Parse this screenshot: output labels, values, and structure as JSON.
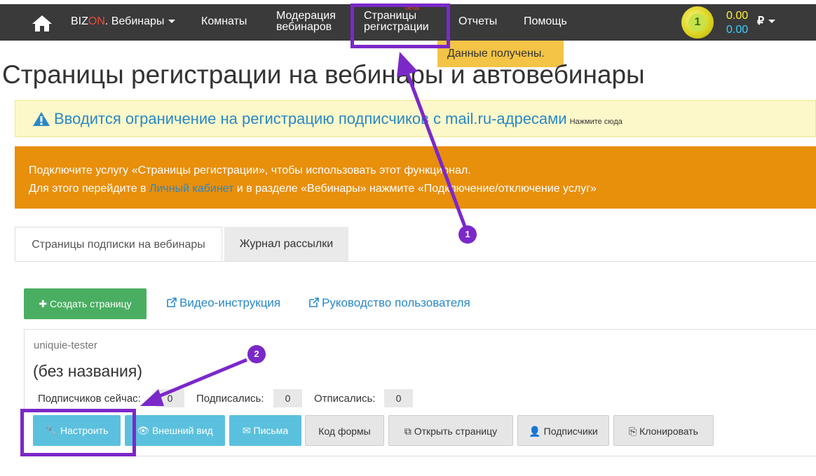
{
  "navbar": {
    "brand_prefix": "BIZ",
    "brand_on": "ON",
    "brand_suffix": ". Вебинары",
    "items": {
      "rooms": "Комнаты",
      "moderation_line1": "Модерация",
      "moderation_line2": "вебинаров",
      "reg_pages_line1": "Страницы",
      "reg_pages_line2": "регистрации",
      "reg_pages_badge": "beta",
      "reports": "Отчеты",
      "help": "Помощь"
    },
    "balance_primary": "0.00",
    "balance_secondary": "0.00",
    "currency": "₽",
    "coin_digit": "1",
    "colors": {
      "background": "#3a3a3a",
      "balance_primary": "#fff13a",
      "balance_secondary": "#3ad1ff"
    }
  },
  "tooltip": "Данные получены.",
  "page_title": "Страницы регистрации на вебинары и автовебинары",
  "yellow_alert": {
    "text": "Вводится ограничение на регистрацию подписчиков с mail.ru-адресами",
    "link": "Нажмите сюда"
  },
  "orange_alert": {
    "line1": "Подключите услугу «Страницы регистрации», чтобы использовать этот функционал.",
    "line2_before": "Для этого перейдите в ",
    "line2_link": "Личный кабинет",
    "line2_after": " и в разделе «Вебинары» нажмите «Подключение/отключение услуг»"
  },
  "tabs": [
    {
      "label": "Страницы подписки на вебинары",
      "active": true
    },
    {
      "label": "Журнал рассылки",
      "active": false
    }
  ],
  "toolbar": {
    "create_button": "Создать страницу",
    "video_link": "Видео-инструкция",
    "guide_link": "Руководство пользователя"
  },
  "page_card": {
    "slug": "uniquie-tester",
    "name": "(без названия)",
    "stats": [
      {
        "label": "Подписчиков сейчас:",
        "value": "0"
      },
      {
        "label": "Подписались:",
        "value": "0"
      },
      {
        "label": "Отписались:",
        "value": "0"
      }
    ],
    "buttons": {
      "configure": "Настроить",
      "appearance": "Внешний вид",
      "letters": "Письма",
      "form_code": "Код формы",
      "open_page": "Открыть страницу",
      "subscribers": "Подписчики",
      "clone": "Клонировать"
    }
  },
  "annotations": {
    "marker1": "1",
    "marker2": "2",
    "color": "#7b28c9"
  }
}
